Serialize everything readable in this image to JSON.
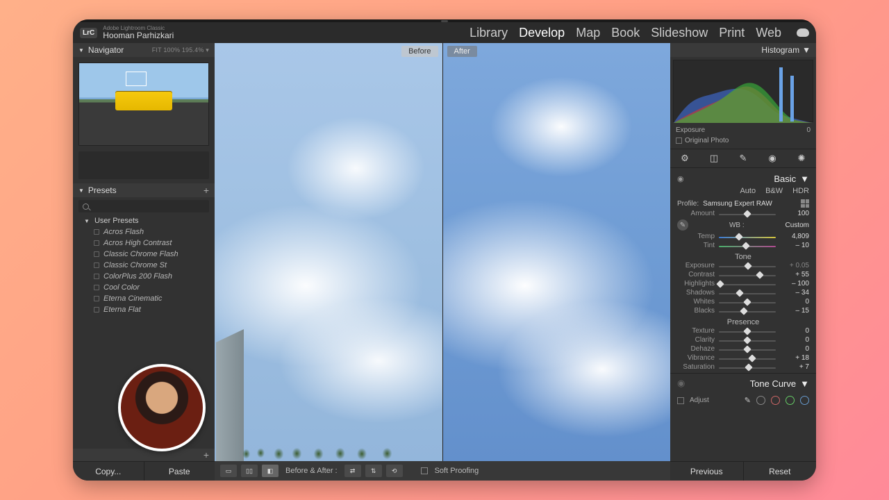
{
  "titlebar": {
    "app_name": "Adobe Lightroom Classic",
    "user_name": "Hooman Parhizkari",
    "logo_text": "LrC"
  },
  "modules": {
    "library": "Library",
    "develop": "Develop",
    "map": "Map",
    "book": "Book",
    "slideshow": "Slideshow",
    "print": "Print",
    "web": "Web"
  },
  "navigator": {
    "title": "Navigator",
    "meta": "FIT   100%   195.4% ▾"
  },
  "presets": {
    "title": "Presets",
    "group": "User Presets",
    "items": [
      "Acros Flash",
      "Acros High Contrast",
      "Classic Chrome Flash",
      "Classic Chrome St",
      "ColorPlus 200 Flash",
      "Cool Color",
      "Eterna Cinematic",
      "Eterna Flat"
    ]
  },
  "left_buttons": {
    "copy": "Copy...",
    "paste": "Paste"
  },
  "canvas": {
    "before": "Before",
    "after": "After"
  },
  "center_toolbar": {
    "ba_label": "Before & After :",
    "soft_proofing": "Soft Proofing"
  },
  "histogram": {
    "title": "Histogram",
    "readout_label": "Exposure",
    "readout_value": "0",
    "original_photo": "Original Photo"
  },
  "basic": {
    "title": "Basic",
    "tabs": {
      "auto": "Auto",
      "bw": "B&W",
      "hdr": "HDR"
    },
    "profile_label": "Profile:",
    "profile_value": "Samsung Expert RAW",
    "amount_label": "Amount",
    "amount_value": "100",
    "wb_label": "WB :",
    "wb_value": "Custom",
    "temp": {
      "label": "Temp",
      "value": "4,809"
    },
    "tint": {
      "label": "Tint",
      "value": "– 10"
    },
    "tone_label": "Tone",
    "exposure": {
      "label": "Exposure",
      "value": "+ 0.05"
    },
    "contrast": {
      "label": "Contrast",
      "value": "+ 55"
    },
    "highlights": {
      "label": "Highlights",
      "value": "– 100"
    },
    "shadows": {
      "label": "Shadows",
      "value": "– 34"
    },
    "whites": {
      "label": "Whites",
      "value": "0"
    },
    "blacks": {
      "label": "Blacks",
      "value": "– 15"
    },
    "presence_label": "Presence",
    "texture": {
      "label": "Texture",
      "value": "0"
    },
    "clarity": {
      "label": "Clarity",
      "value": "0"
    },
    "dehaze": {
      "label": "Dehaze",
      "value": "0"
    },
    "vibrance": {
      "label": "Vibrance",
      "value": "+ 18"
    },
    "saturation": {
      "label": "Saturation",
      "value": "+ 7"
    }
  },
  "tone_curve": {
    "title": "Tone Curve",
    "adjust": "Adjust"
  },
  "right_buttons": {
    "previous": "Previous",
    "reset": "Reset"
  }
}
